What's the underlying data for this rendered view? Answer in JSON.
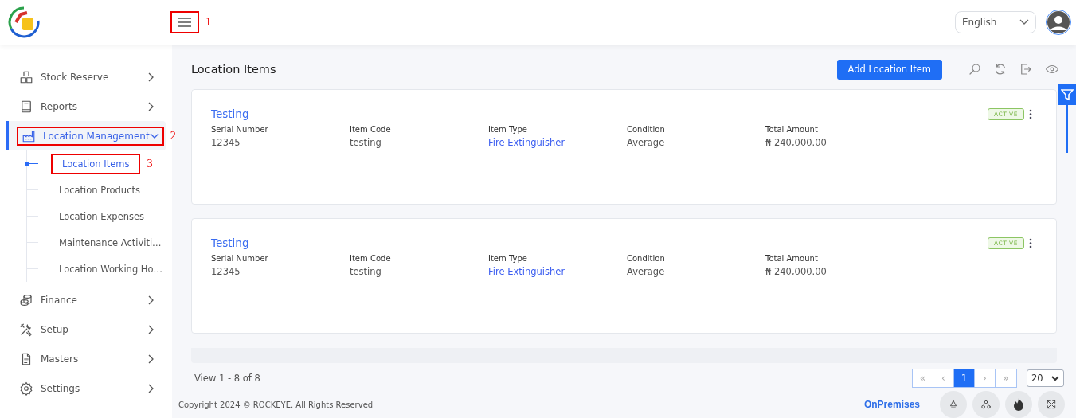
{
  "header": {
    "menu_callout": "1",
    "language": "English"
  },
  "sidebar": {
    "items": [
      {
        "label": "Stock Reserve",
        "selected": false,
        "expanded": false
      },
      {
        "label": "Reports",
        "selected": false,
        "expanded": false
      },
      {
        "label": "Location Management",
        "selected": true,
        "expanded": true,
        "callout": "2",
        "children": [
          {
            "label": "Location Items",
            "selected": true,
            "callout": "3"
          },
          {
            "label": "Location Products",
            "selected": false
          },
          {
            "label": "Location Expenses",
            "selected": false
          },
          {
            "label": "Maintenance Activiti…",
            "selected": false
          },
          {
            "label": "Location Working Ho…",
            "selected": false
          }
        ]
      },
      {
        "label": "Finance",
        "selected": false,
        "expanded": false
      },
      {
        "label": "Setup",
        "selected": false,
        "expanded": false
      },
      {
        "label": "Masters",
        "selected": false,
        "expanded": false
      },
      {
        "label": "Settings",
        "selected": false,
        "expanded": false
      }
    ]
  },
  "page": {
    "title": "Location Items",
    "add_button": "Add Location Item"
  },
  "cards": [
    {
      "title": "Testing",
      "status": "ACTIVE",
      "fields": [
        {
          "label": "Serial Number",
          "value": "12345",
          "kind": "text"
        },
        {
          "label": "Item Code",
          "value": "testing",
          "kind": "text"
        },
        {
          "label": "Item Type",
          "value": "Fire Extinguisher",
          "kind": "link"
        },
        {
          "label": "Condition",
          "value": "Average",
          "kind": "text"
        },
        {
          "label": "Total Amount",
          "value": "₦ 240,000.00",
          "kind": "text"
        }
      ]
    },
    {
      "title": "Testing",
      "status": "ACTIVE",
      "fields": [
        {
          "label": "Serial Number",
          "value": "12345",
          "kind": "text"
        },
        {
          "label": "Item Code",
          "value": "testing",
          "kind": "text"
        },
        {
          "label": "Item Type",
          "value": "Fire Extinguisher",
          "kind": "link"
        },
        {
          "label": "Condition",
          "value": "Average",
          "kind": "text"
        },
        {
          "label": "Total Amount",
          "value": "₦ 240,000.00",
          "kind": "text"
        }
      ]
    }
  ],
  "pagination": {
    "summary": "View 1 - 8 of 8",
    "first": "«",
    "prev": "‹",
    "pages": [
      {
        "label": "1",
        "selected": true
      }
    ],
    "next": "›",
    "last": "»",
    "page_size": "20"
  },
  "footer": {
    "copyright": "Copyright 2024 © ROCKEYE. All Rights Reserved",
    "mode": "OnPremises"
  }
}
